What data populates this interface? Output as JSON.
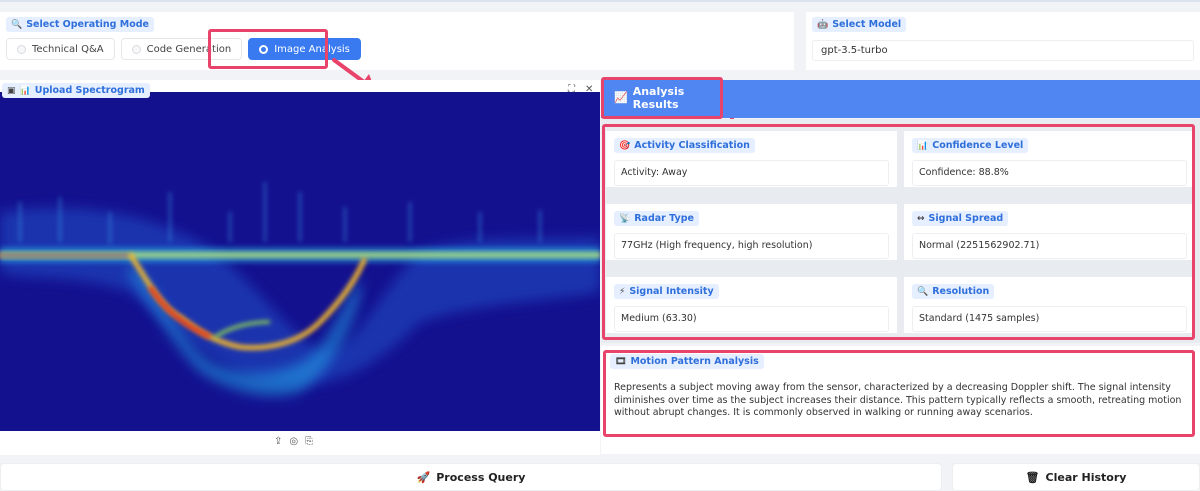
{
  "mode_section": {
    "label": "Select Operating Mode",
    "options": [
      "Technical Q&A",
      "Code Generation",
      "Image Analysis"
    ],
    "selected": "Image Analysis"
  },
  "model_section": {
    "label": "Select Model",
    "value": "gpt-3.5-turbo"
  },
  "upload": {
    "label": "Upload Spectrogram",
    "expand": "⛶",
    "close": "✕"
  },
  "results": {
    "title": "Analysis Results",
    "cards": {
      "activity": {
        "label": "Activity Classification",
        "value": "Activity: Away"
      },
      "confidence": {
        "label": "Confidence Level",
        "value": "Confidence: 88.8%"
      },
      "radar": {
        "label": "Radar Type",
        "value": "77GHz (High frequency, high resolution)"
      },
      "spread": {
        "label": "Signal Spread",
        "value": "Normal (2251562902.71)"
      },
      "intensity": {
        "label": "Signal Intensity",
        "value": "Medium (63.30)"
      },
      "resolution": {
        "label": "Resolution",
        "value": "Standard (1475 samples)"
      }
    },
    "motion": {
      "label": "Motion Pattern Analysis",
      "text": "Represents a subject moving away from the sensor, characterized by a decreasing Doppler shift. The signal intensity diminishes over time as the subject increases their distance. This pattern typically reflects a smooth, retreating motion without abrupt changes. It is commonly observed in walking or running away scenarios."
    }
  },
  "buttons": {
    "process": "Process Query",
    "clear": "Clear History"
  },
  "colors": {
    "accent": "#4f86f2",
    "highlight": "#e8436b",
    "spectrogram_bg": "#1a1690"
  }
}
